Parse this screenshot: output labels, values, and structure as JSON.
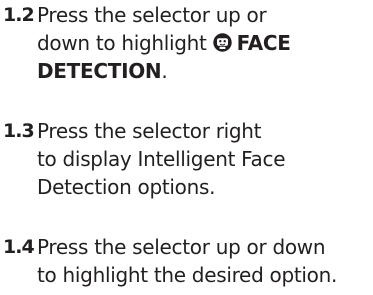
{
  "steps": [
    {
      "number": "1.2",
      "lines": [
        "Press the selector up or",
        "down to highlight "
      ],
      "icon": "face-detection-icon",
      "highlight_first": "FACE",
      "highlight_second": "DETECTION",
      "trailing": "."
    },
    {
      "number": "1.3",
      "lines": [
        "Press the selector right",
        "to display Intelligent Face",
        "Detection options."
      ]
    },
    {
      "number": "1.4",
      "lines": [
        "Press the selector up or down",
        "to highlight the desired option."
      ]
    }
  ]
}
